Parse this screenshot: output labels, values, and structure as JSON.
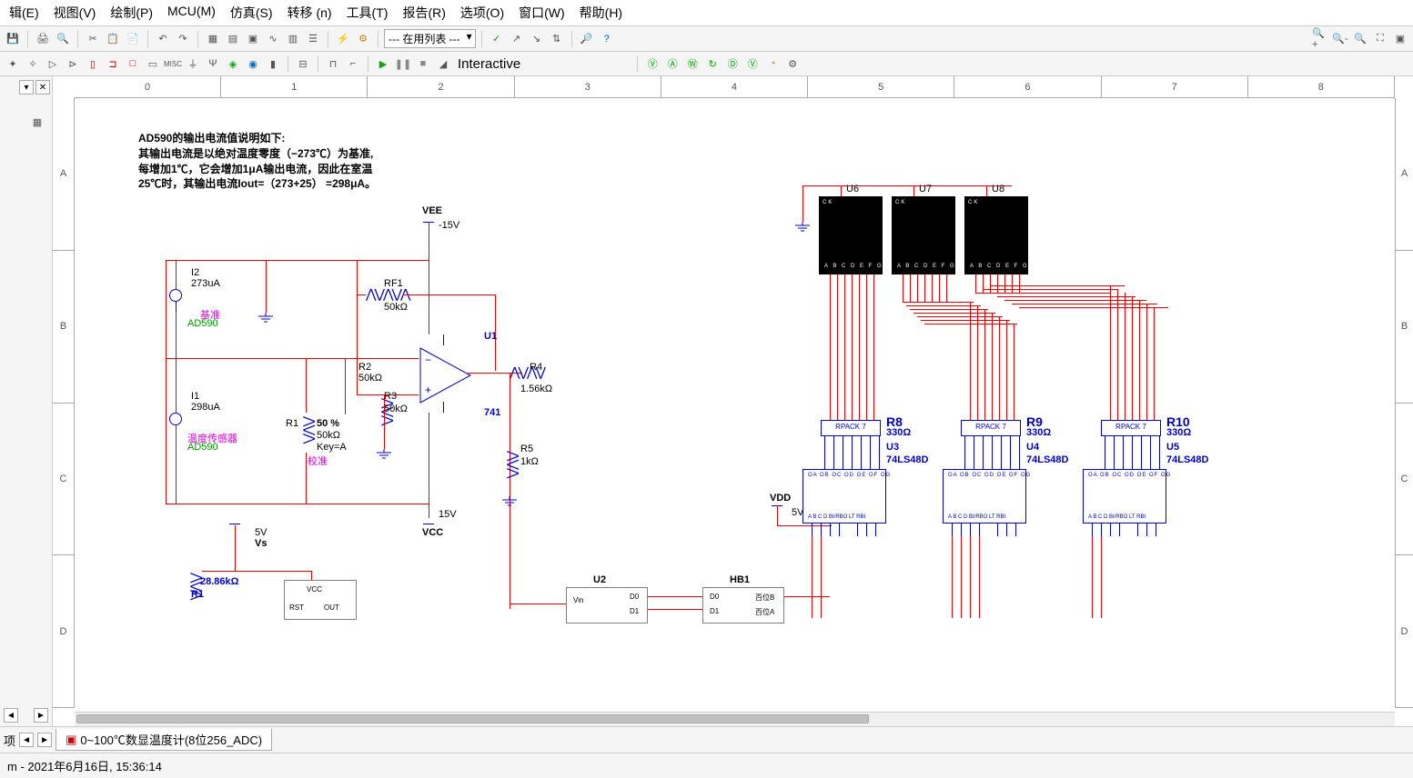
{
  "menubar": {
    "edit": "辑(E)",
    "view": "视图(V)",
    "draw": "绘制(P)",
    "mcu": "MCU(M)",
    "sim": "仿真(S)",
    "transfer": "转移 (n)",
    "tools": "工具(T)",
    "report": "报告(R)",
    "options": "选项(O)",
    "window": "窗口(W)",
    "help": "帮助(H)"
  },
  "toolbar": {
    "list_label": "--- 在用列表 ---",
    "mode_label": "Interactive"
  },
  "ruler_h": [
    "0",
    "1",
    "2",
    "3",
    "4",
    "5",
    "6",
    "7",
    "8"
  ],
  "ruler_v": [
    "A",
    "B",
    "C",
    "D"
  ],
  "schematic": {
    "desc_l1": "AD590的输出电流值说明如下:",
    "desc_l2": "其输出电流是以绝对温度零度（−273℃）为基准,",
    "desc_l3": "每增加1℃，它会增加1μA输出电流，因此在室温",
    "desc_l4": "25℃时，其输出电流Iout=（273+25） =298μA。",
    "VEE": "VEE",
    "VEE_v": "-15V",
    "VCC": "VCC",
    "VCC_v": "15V",
    "VDD": "VDD",
    "VDD_v": "5V",
    "Vs": "Vs",
    "Vs_v": "5V",
    "I2": "I2",
    "I2_v": "273uA",
    "I2_n": "基准",
    "I2_t": "AD590",
    "I1": "I1",
    "I1_v": "298uA",
    "I1_n": "温度传感器",
    "I1_t": "AD590",
    "R1": "R1",
    "R1_pct": "50 %",
    "R1_v": "50kΩ",
    "R1_k": "Key=A",
    "R1_n": "校准",
    "RF1": "RF1",
    "RF1_v": "50kΩ",
    "R2": "R2",
    "R2_v": "50kΩ",
    "R3": "R3",
    "R3_v": "50kΩ",
    "R4": "R4",
    "R4_v": "1.56kΩ",
    "R5": "R5",
    "R5_v": "1kΩ",
    "Rs": "28.86kΩ",
    "Rs_n": "R1",
    "U1": "U1",
    "U1_t": "741",
    "U2": "U2",
    "U2_vin": "Vin",
    "U2_d0": "D0",
    "U2_d1": "D1",
    "U2b_rst": "RST",
    "U2b_out": "OUT",
    "U2b_vcc": "VCC",
    "HB1": "HB1",
    "HB1_d0": "D0",
    "HB1_d1": "D1",
    "HB1_b": "百位B",
    "HB1_a": "百位A",
    "U3": "U3",
    "U4": "U4",
    "U5": "U5",
    "Ux_t": "74LS48D",
    "U6": "U6",
    "U7": "U7",
    "U8": "U8",
    "R8": "R8",
    "R9": "R9",
    "R10": "R10",
    "Rx_v": "330Ω",
    "RPACK": "RPACK 7",
    "seg_pins": "A B C D E F G",
    "ck": "CK",
    "hex_row1": "OA OB OC OD OE OF OG",
    "hex_row2": "A B C D    BI/RBO LT RBI"
  },
  "tabs": {
    "options": "项",
    "doc": "0~100℃数显温度计(8位256_ADC)"
  },
  "status": {
    "text": "m  -  2021年6月16日, 15:36:14"
  }
}
